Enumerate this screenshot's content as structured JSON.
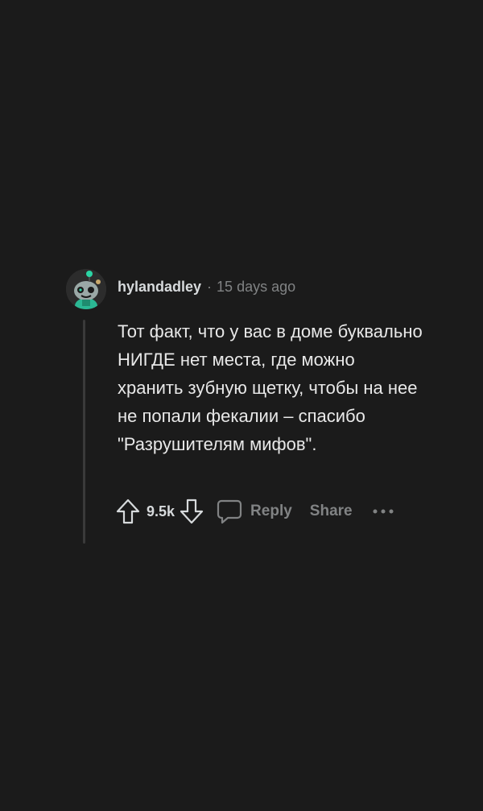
{
  "comment": {
    "avatar_icon": "snoo-avatar-icon",
    "username": "hylandadley",
    "separator": "·",
    "timestamp": "15 days ago",
    "body": "Тот факт, что у вас в доме буквально НИГДЕ нет места, где можно хранить зубную щетку, чтобы на нее не попали фекалии – спасибо \"Разрушителям мифов\".",
    "actions": {
      "upvote_icon": "upvote-arrow-icon",
      "vote_count": "9.5k",
      "downvote_icon": "downvote-arrow-icon",
      "reply_icon": "speech-bubble-icon",
      "reply_label": "Reply",
      "share_label": "Share",
      "more_icon": "more-options-icon"
    }
  },
  "colors": {
    "background": "#1b1b1b",
    "text_primary": "#d7dadc",
    "text_muted": "#818384",
    "thread_line": "#3a3a3a",
    "avatar_accent": "#2bd4a4"
  }
}
